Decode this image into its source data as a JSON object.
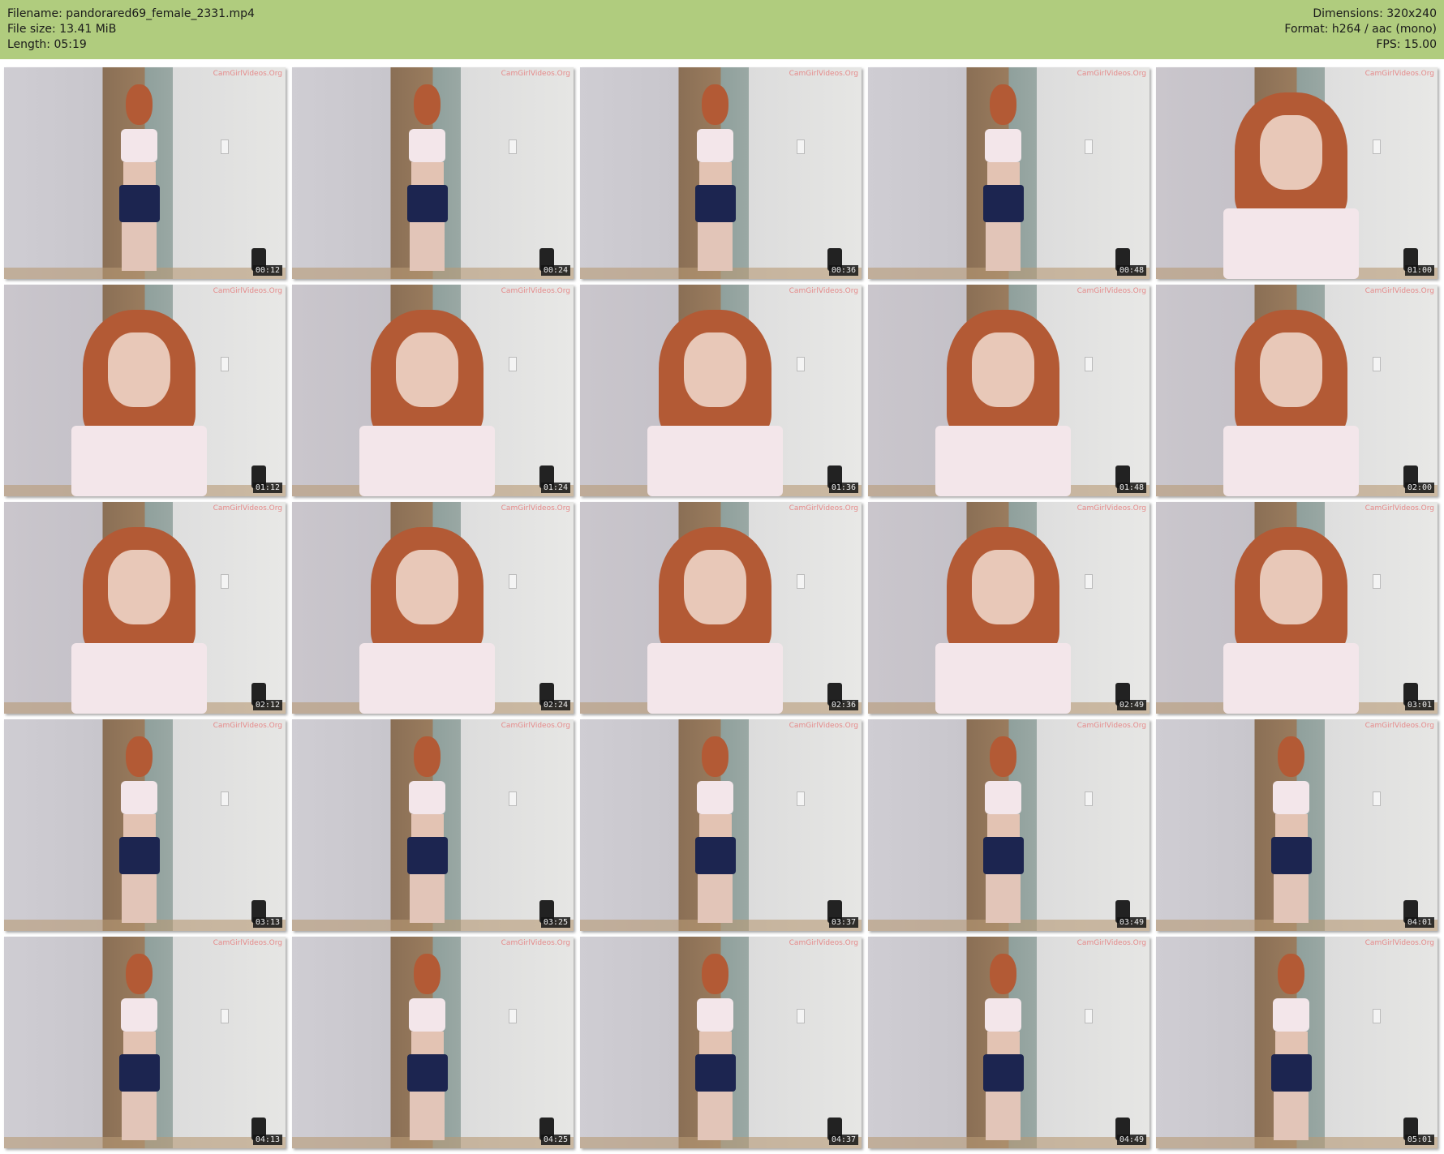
{
  "header": {
    "filename": "Filename: pandorared69_female_2331.mp4",
    "filesize": "File size: 13.41 MiB",
    "length": "Length: 05:19",
    "dimensions": "Dimensions: 320x240",
    "format": "Format: h264 / aac (mono)",
    "fps": "FPS: 15.00"
  },
  "watermark": "CamGirlVideos.Org",
  "colors": {
    "header_bg": "#b0cc7e"
  },
  "thumbnails": [
    {
      "time": "00:12",
      "shot": "full"
    },
    {
      "time": "00:24",
      "shot": "full"
    },
    {
      "time": "00:36",
      "shot": "full"
    },
    {
      "time": "00:48",
      "shot": "full"
    },
    {
      "time": "01:00",
      "shot": "close"
    },
    {
      "time": "01:12",
      "shot": "close"
    },
    {
      "time": "01:24",
      "shot": "close"
    },
    {
      "time": "01:36",
      "shot": "close"
    },
    {
      "time": "01:48",
      "shot": "close"
    },
    {
      "time": "02:00",
      "shot": "close"
    },
    {
      "time": "02:12",
      "shot": "close"
    },
    {
      "time": "02:24",
      "shot": "close"
    },
    {
      "time": "02:36",
      "shot": "close"
    },
    {
      "time": "02:49",
      "shot": "close"
    },
    {
      "time": "03:01",
      "shot": "close"
    },
    {
      "time": "03:13",
      "shot": "full"
    },
    {
      "time": "03:25",
      "shot": "full"
    },
    {
      "time": "03:37",
      "shot": "full"
    },
    {
      "time": "03:49",
      "shot": "full"
    },
    {
      "time": "04:01",
      "shot": "full"
    },
    {
      "time": "04:13",
      "shot": "full"
    },
    {
      "time": "04:25",
      "shot": "full"
    },
    {
      "time": "04:37",
      "shot": "full"
    },
    {
      "time": "04:49",
      "shot": "full"
    },
    {
      "time": "05:01",
      "shot": "full"
    }
  ]
}
